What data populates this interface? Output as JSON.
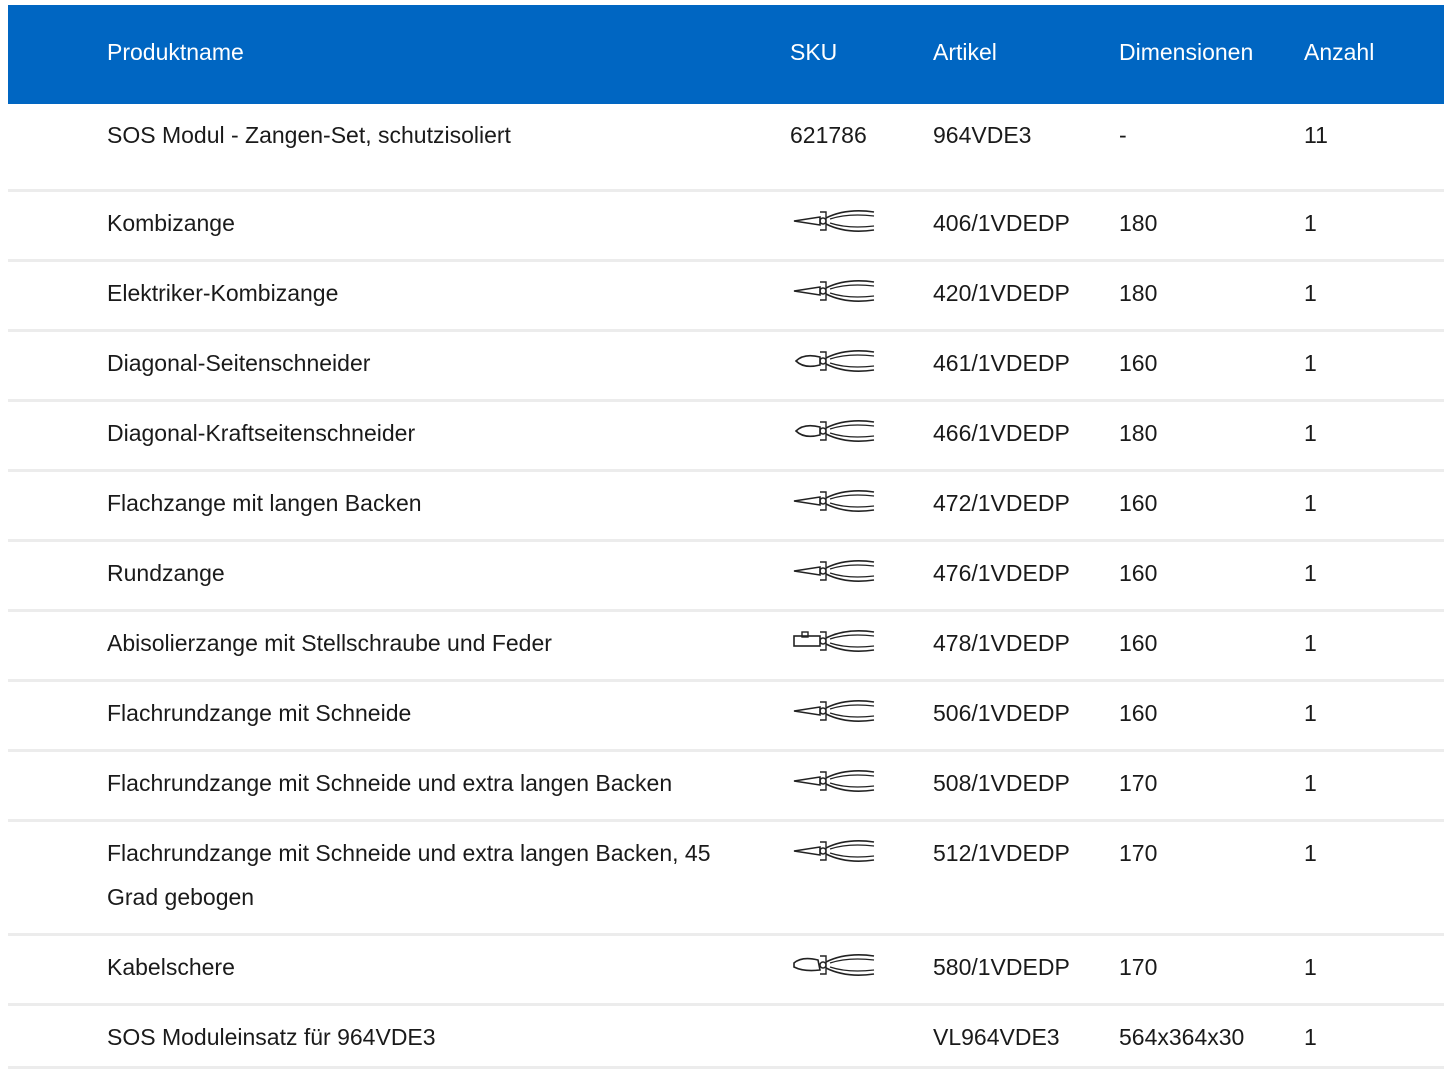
{
  "header": {
    "name": "Produktname",
    "sku": "SKU",
    "article": "Artikel",
    "dimensions": "Dimensionen",
    "quantity": "Anzahl"
  },
  "rows": [
    {
      "name": "SOS Modul - Zangen-Set, schutzisoliert",
      "sku": "621786",
      "icon": null,
      "article": "964VDE3",
      "dim": "-",
      "qty": "11"
    },
    {
      "name": "Kombizange",
      "sku": null,
      "icon": "combination-pliers-icon",
      "article": "406/1VDEDP",
      "dim": "180",
      "qty": "1"
    },
    {
      "name": "Elektriker-Kombizange",
      "sku": null,
      "icon": "electrician-pliers-icon",
      "article": "420/1VDEDP",
      "dim": "180",
      "qty": "1"
    },
    {
      "name": "Diagonal-Seitenschneider",
      "sku": null,
      "icon": "diagonal-cutter-icon",
      "article": "461/1VDEDP",
      "dim": "160",
      "qty": "1"
    },
    {
      "name": "Diagonal-Kraftseitenschneider",
      "sku": null,
      "icon": "power-diagonal-cutter-icon",
      "article": "466/1VDEDP",
      "dim": "180",
      "qty": "1"
    },
    {
      "name": "Flachzange mit langen Backen",
      "sku": null,
      "icon": "flat-nose-pliers-icon",
      "article": "472/1VDEDP",
      "dim": "160",
      "qty": "1"
    },
    {
      "name": "Rundzange",
      "sku": null,
      "icon": "round-nose-pliers-icon",
      "article": "476/1VDEDP",
      "dim": "160",
      "qty": "1"
    },
    {
      "name": "Abisolierzange mit Stellschraube und Feder",
      "sku": null,
      "icon": "wire-stripper-icon",
      "article": "478/1VDEDP",
      "dim": "160",
      "qty": "1"
    },
    {
      "name": "Flachrundzange mit Schneide",
      "sku": null,
      "icon": "needle-nose-pliers-icon",
      "article": "506/1VDEDP",
      "dim": "160",
      "qty": "1"
    },
    {
      "name": "Flachrundzange mit Schneide und extra langen Backen",
      "sku": null,
      "icon": "long-needle-nose-pliers-icon",
      "article": "508/1VDEDP",
      "dim": "170",
      "qty": "1"
    },
    {
      "name": "Flachrundzange mit Schneide und extra langen Backen, 45 Grad gebogen",
      "sku": null,
      "icon": "bent-needle-nose-pliers-icon",
      "article": "512/1VDEDP",
      "dim": "170",
      "qty": "1"
    },
    {
      "name": "Kabelschere",
      "sku": null,
      "icon": "cable-shears-icon",
      "article": "580/1VDEDP",
      "dim": "170",
      "qty": "1"
    },
    {
      "name": "SOS Moduleinsatz für 964VDE3",
      "sku": null,
      "icon": null,
      "article": "VL964VDE3",
      "dim": "564x364x30",
      "qty": "1"
    }
  ],
  "colors": {
    "header_bg": "#0066c2",
    "header_text": "#ffffff",
    "divider": "#ececec"
  }
}
